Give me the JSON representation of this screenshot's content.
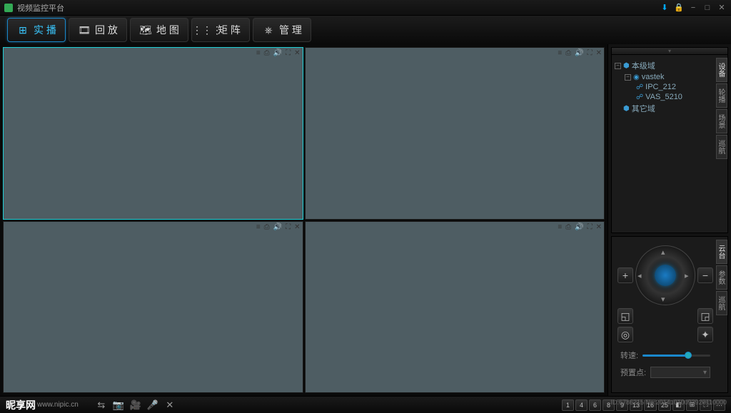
{
  "app": {
    "title": "视频监控平台"
  },
  "nav": [
    {
      "label": "实 播",
      "icon": "grid"
    },
    {
      "label": "回 放",
      "icon": "reel"
    },
    {
      "label": "地 图",
      "icon": "map"
    },
    {
      "label": "矩 阵",
      "icon": "matrix"
    },
    {
      "label": "管 理",
      "icon": "wheel"
    }
  ],
  "tree": {
    "root": "本级域",
    "vendor": "vastek",
    "cam1": "IPC_212",
    "cam2": "VAS_5210",
    "other": "其它域"
  },
  "side_tabs": [
    "设备",
    "轮播",
    "场景",
    "巡航"
  ],
  "ptz_tabs": [
    "云台",
    "参数",
    "巡航"
  ],
  "ptz": {
    "speed_label": "转速:",
    "preset_label": "预置点:"
  },
  "layouts": [
    "1",
    "4",
    "6",
    "8",
    "9",
    "13",
    "16",
    "25",
    "◧",
    "⊞",
    "⛶",
    "···"
  ],
  "watermark": {
    "brand": "昵享网",
    "url": "www.nipic.cn"
  },
  "stamp": "ID:6786215 No:20141010093920110000"
}
